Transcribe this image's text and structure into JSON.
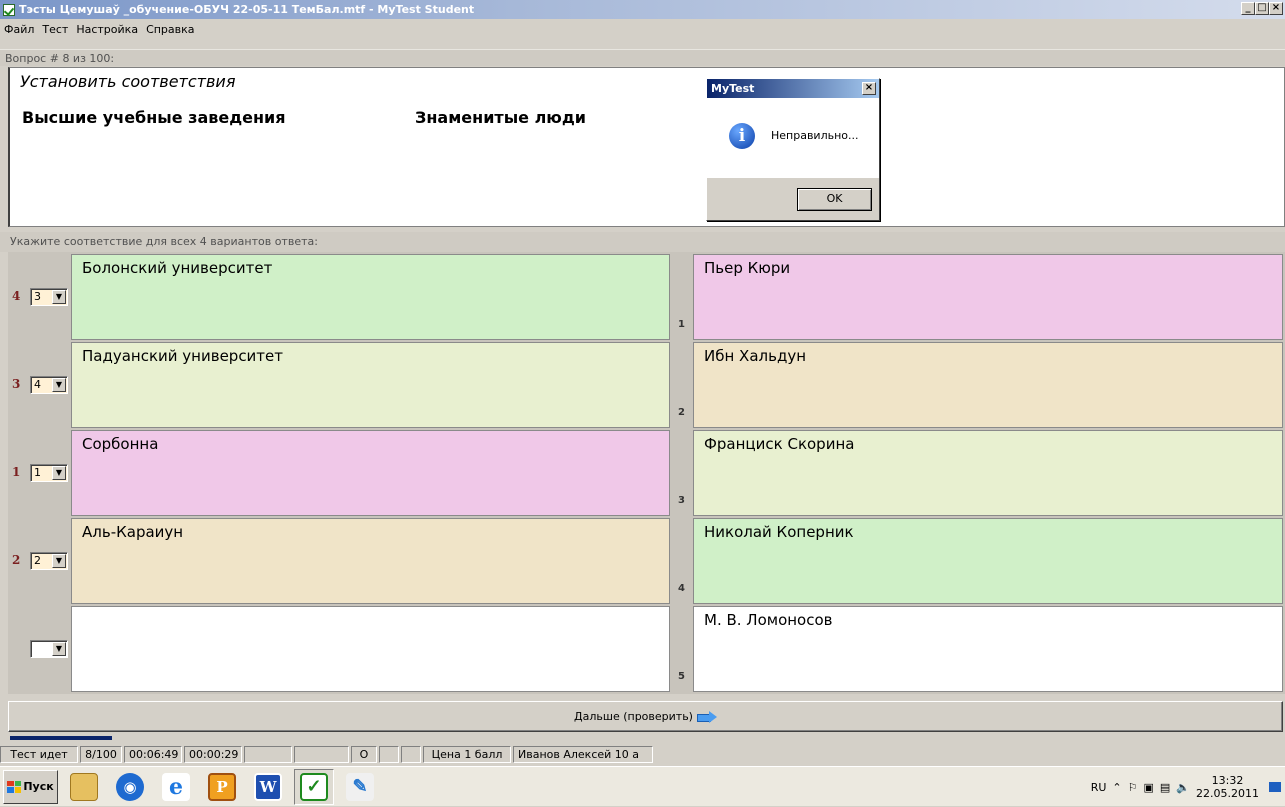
{
  "window": {
    "title": "Тэсты Цемушаў _обучение-ОБУЧ 22-05-11 ТемБал.mtf - MyTest Student",
    "min": "_",
    "max": "□",
    "close": "×"
  },
  "menu": [
    "Файл",
    "Тест",
    "Настройка",
    "Справка"
  ],
  "question_header": "Вопрос # 8 из 100:",
  "question": {
    "instruction": "Установить соответствия",
    "left_heading": "Высшие учебные заведения",
    "right_heading": "Знаменитые люди"
  },
  "dialog": {
    "title": "MyTest",
    "close": "×",
    "icon": "info-icon",
    "message": "Неправильно...",
    "ok": "OK"
  },
  "hint": "Укажите соответствие для всех 4 вариантов ответа:",
  "left_items": [
    {
      "num": "4",
      "select": "3",
      "text": "Болонский университет",
      "color": "#d0f0c8"
    },
    {
      "num": "3",
      "select": "4",
      "text": "Падуанский университет",
      "color": "#e8f0d0"
    },
    {
      "num": "1",
      "select": "1",
      "text": "Сорбонна",
      "color": "#f0c8e8"
    },
    {
      "num": "2",
      "select": "2",
      "text": "Аль-Караиун",
      "color": "#f0e4c8"
    },
    {
      "num": "",
      "select": "",
      "text": "",
      "color": "#ffffff"
    }
  ],
  "right_items": [
    {
      "num": "1",
      "text": "Пьер Кюри",
      "color": "#f0c8e8"
    },
    {
      "num": "2",
      "text": "Ибн Хальдун",
      "color": "#f0e4c8"
    },
    {
      "num": "3",
      "text": "Франциск Скорина",
      "color": "#e8f0d0"
    },
    {
      "num": "4",
      "text": "Николай Коперник",
      "color": "#d0f0c8"
    },
    {
      "num": "5",
      "text": "М. В. Ломоносов",
      "color": "#ffffff"
    }
  ],
  "next_button": "Дальше (проверить)",
  "progress": 0.08,
  "status": {
    "state": "Тест идет",
    "count": "8/100",
    "elapsed": "00:06:49",
    "question_time": "00:00:29",
    "letter": "О",
    "price": "Цена 1 балл",
    "student": "Иванов Алексей 10 а"
  },
  "taskbar": {
    "start": "Пуск",
    "lang": "RU",
    "time": "13:32",
    "date": "22.05.2011",
    "apps": [
      "file-manager-icon",
      "media-player-icon",
      "internet-explorer-icon",
      "powerpoint-icon",
      "word-icon",
      "mytest-icon",
      "paint-icon"
    ]
  }
}
